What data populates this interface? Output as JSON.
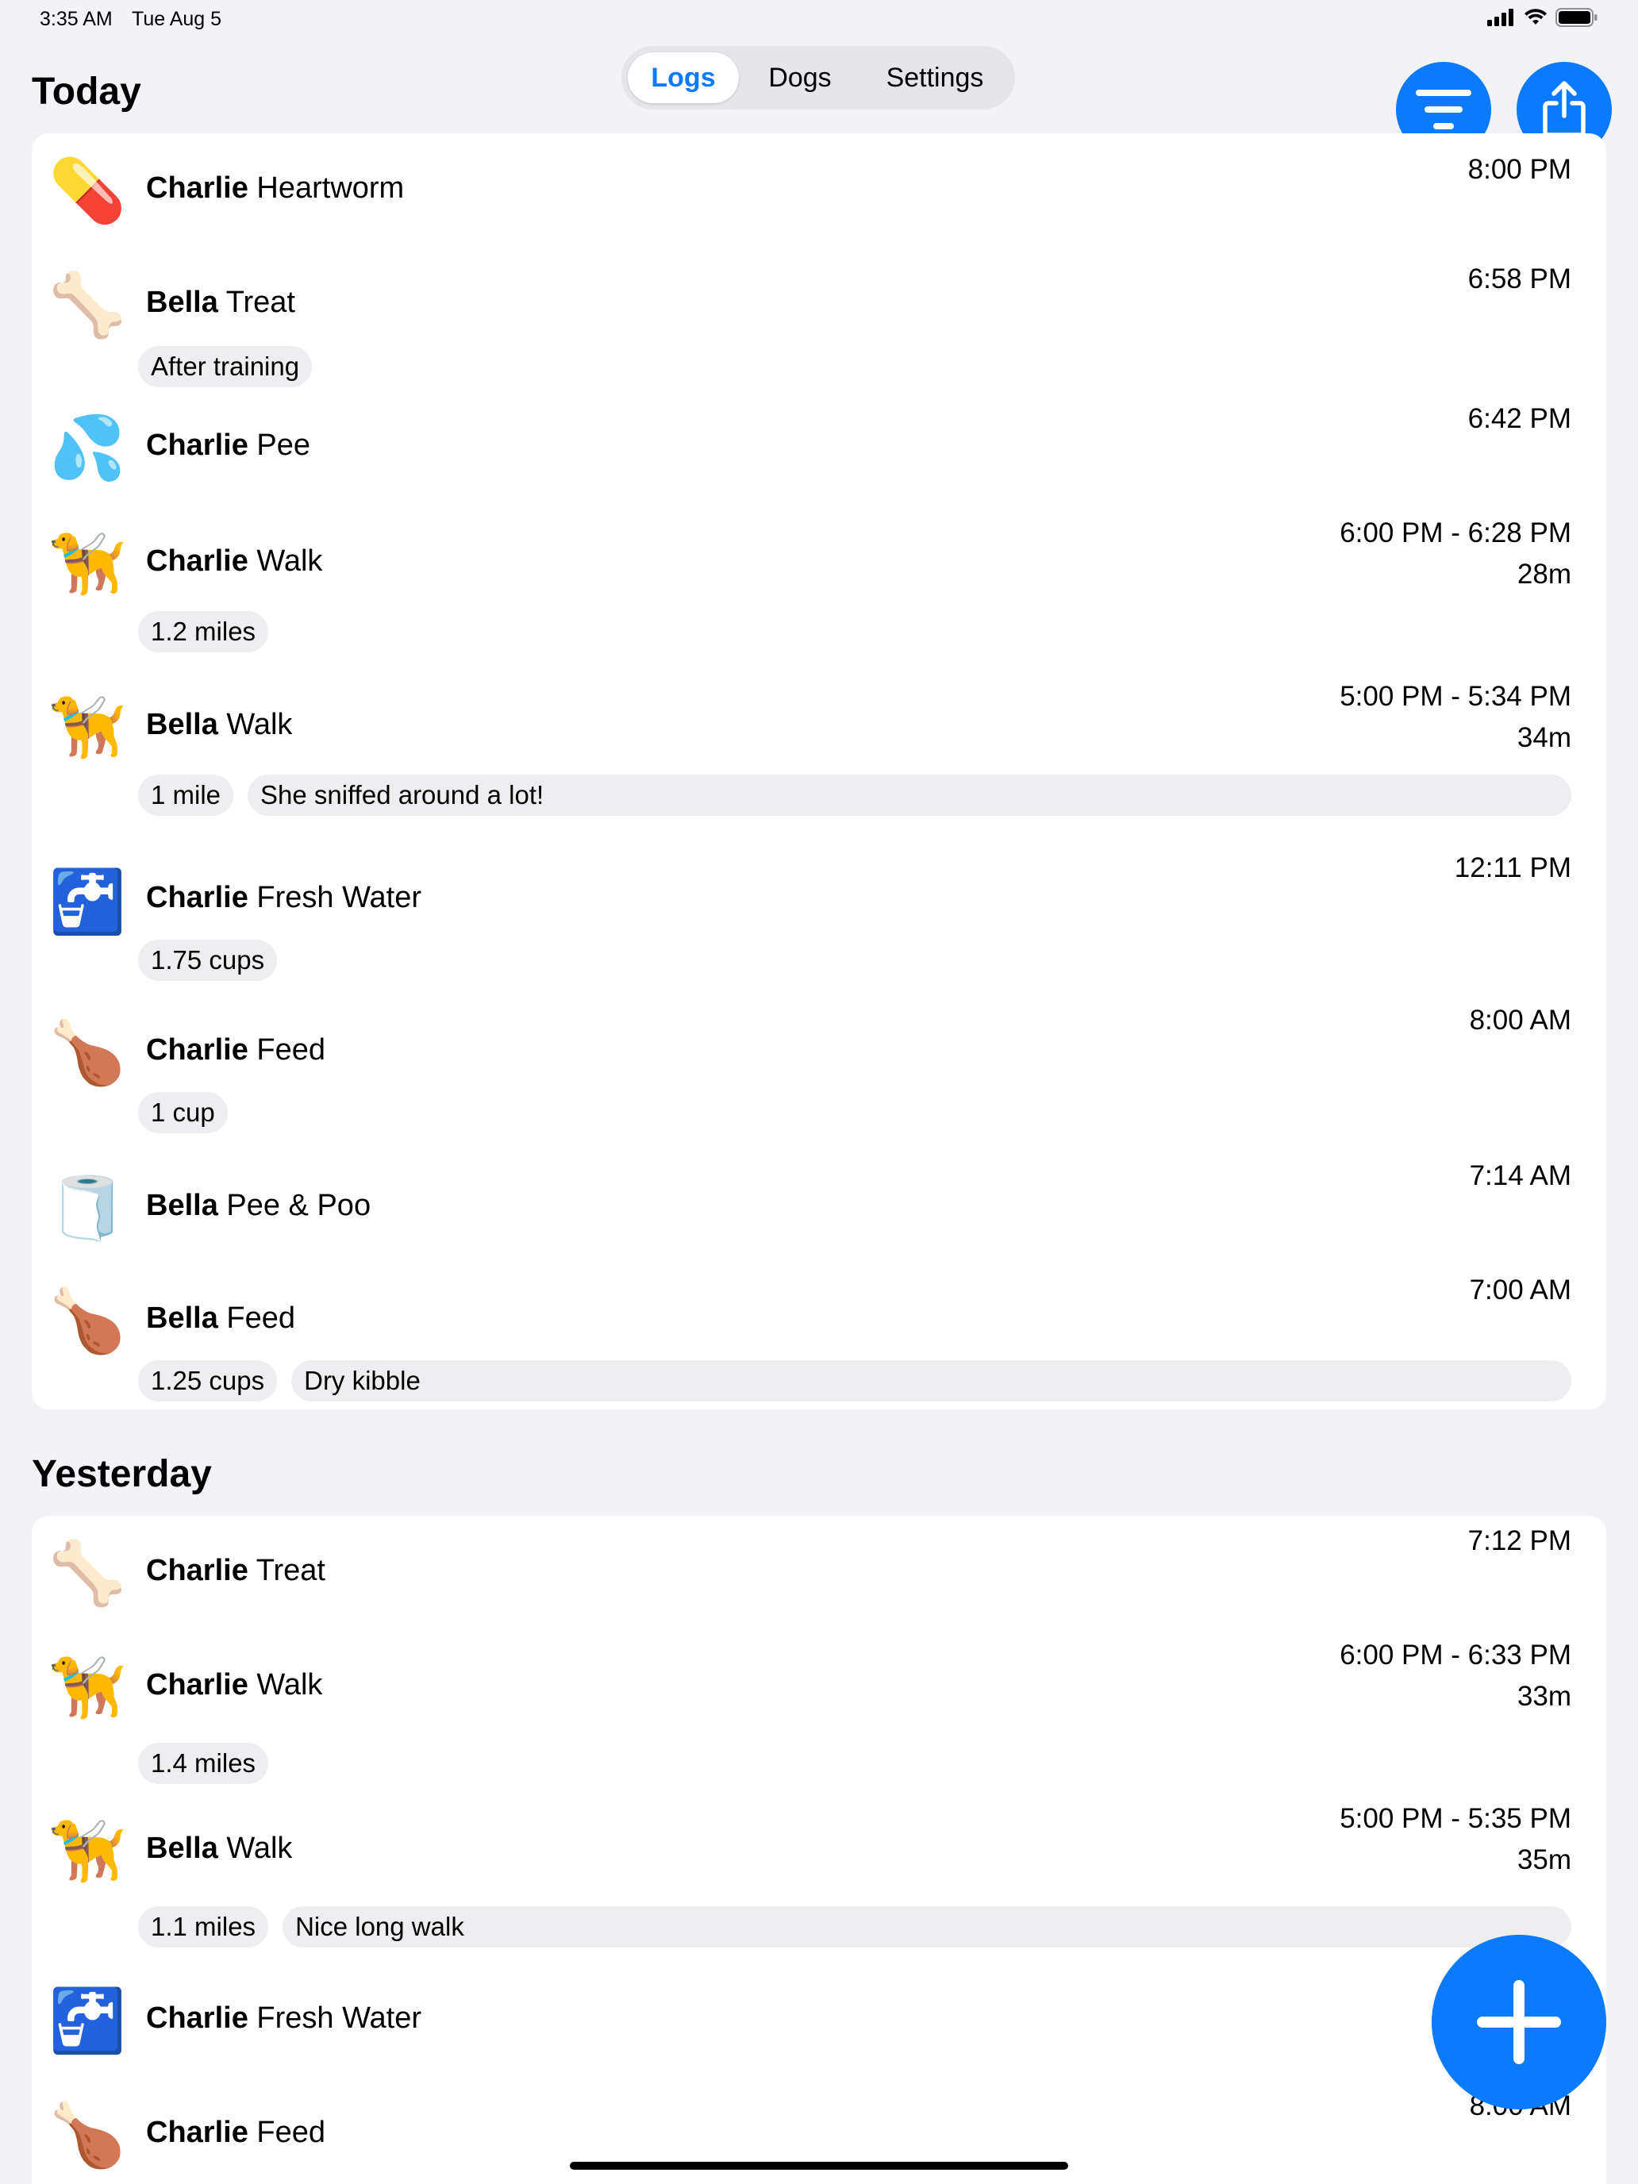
{
  "status_bar": {
    "time": "3:35 AM",
    "date": "Tue Aug 5"
  },
  "tabs": [
    {
      "label": "Logs",
      "active": true
    },
    {
      "label": "Dogs",
      "active": false
    },
    {
      "label": "Settings",
      "active": false
    }
  ],
  "accent_color": "#0a7aff",
  "sections": [
    {
      "title": "Today",
      "entries": [
        {
          "icon": "pill-icon",
          "emoji": "💊",
          "dog": "Charlie",
          "activity": "Heartworm",
          "time": "8:00 PM",
          "duration": "",
          "pills": []
        },
        {
          "icon": "bone-icon",
          "emoji": "🦴",
          "dog": "Bella",
          "activity": "Treat",
          "time": "6:58 PM",
          "duration": "",
          "pills": [
            "After training"
          ]
        },
        {
          "icon": "droplets-icon",
          "emoji": "💦",
          "dog": "Charlie",
          "activity": "Pee",
          "time": "6:42 PM",
          "duration": "",
          "pills": []
        },
        {
          "icon": "guide-dog-icon",
          "emoji": "🦮",
          "dog": "Charlie",
          "activity": "Walk",
          "time": "6:00 PM - 6:28 PM",
          "duration": "28m",
          "pills": [
            "1.2 miles"
          ]
        },
        {
          "icon": "guide-dog-icon",
          "emoji": "🦮",
          "dog": "Bella",
          "activity": "Walk",
          "time": "5:00 PM - 5:34 PM",
          "duration": "34m",
          "pills": [
            "1 mile",
            "She sniffed around a lot!"
          ]
        },
        {
          "icon": "faucet-water-icon",
          "emoji": "🚰",
          "dog": "Charlie",
          "activity": "Fresh Water",
          "time": "12:11 PM",
          "duration": "",
          "pills": [
            "1.75 cups"
          ]
        },
        {
          "icon": "drumstick-icon",
          "emoji": "🍗",
          "dog": "Charlie",
          "activity": "Feed",
          "time": "8:00 AM",
          "duration": "",
          "pills": [
            "1 cup"
          ]
        },
        {
          "icon": "toilet-paper-icon",
          "emoji": "🧻",
          "dog": "Bella",
          "activity": "Pee & Poo",
          "time": "7:14 AM",
          "duration": "",
          "pills": []
        },
        {
          "icon": "drumstick-icon",
          "emoji": "🍗",
          "dog": "Bella",
          "activity": "Feed",
          "time": "7:00 AM",
          "duration": "",
          "pills": [
            "1.25 cups",
            "Dry kibble"
          ]
        }
      ]
    },
    {
      "title": "Yesterday",
      "entries": [
        {
          "icon": "bone-icon",
          "emoji": "🦴",
          "dog": "Charlie",
          "activity": "Treat",
          "time": "7:12 PM",
          "duration": "",
          "pills": []
        },
        {
          "icon": "guide-dog-icon",
          "emoji": "🦮",
          "dog": "Charlie",
          "activity": "Walk",
          "time": "6:00 PM - 6:33 PM",
          "duration": "33m",
          "pills": [
            "1.4 miles"
          ]
        },
        {
          "icon": "guide-dog-icon",
          "emoji": "🦮",
          "dog": "Bella",
          "activity": "Walk",
          "time": "5:00 PM - 5:35 PM",
          "duration": "35m",
          "pills": [
            "1.1 miles",
            "Nice long walk"
          ]
        },
        {
          "icon": "faucet-water-icon",
          "emoji": "🚰",
          "dog": "Charlie",
          "activity": "Fresh Water",
          "time": "",
          "duration": "",
          "pills": []
        },
        {
          "icon": "drumstick-icon",
          "emoji": "🍗",
          "dog": "Charlie",
          "activity": "Feed",
          "time": "8:00 AM",
          "duration": "",
          "pills": []
        }
      ]
    }
  ],
  "buttons": {
    "filter": "filter-icon",
    "share": "share-icon",
    "add": "plus-icon"
  }
}
